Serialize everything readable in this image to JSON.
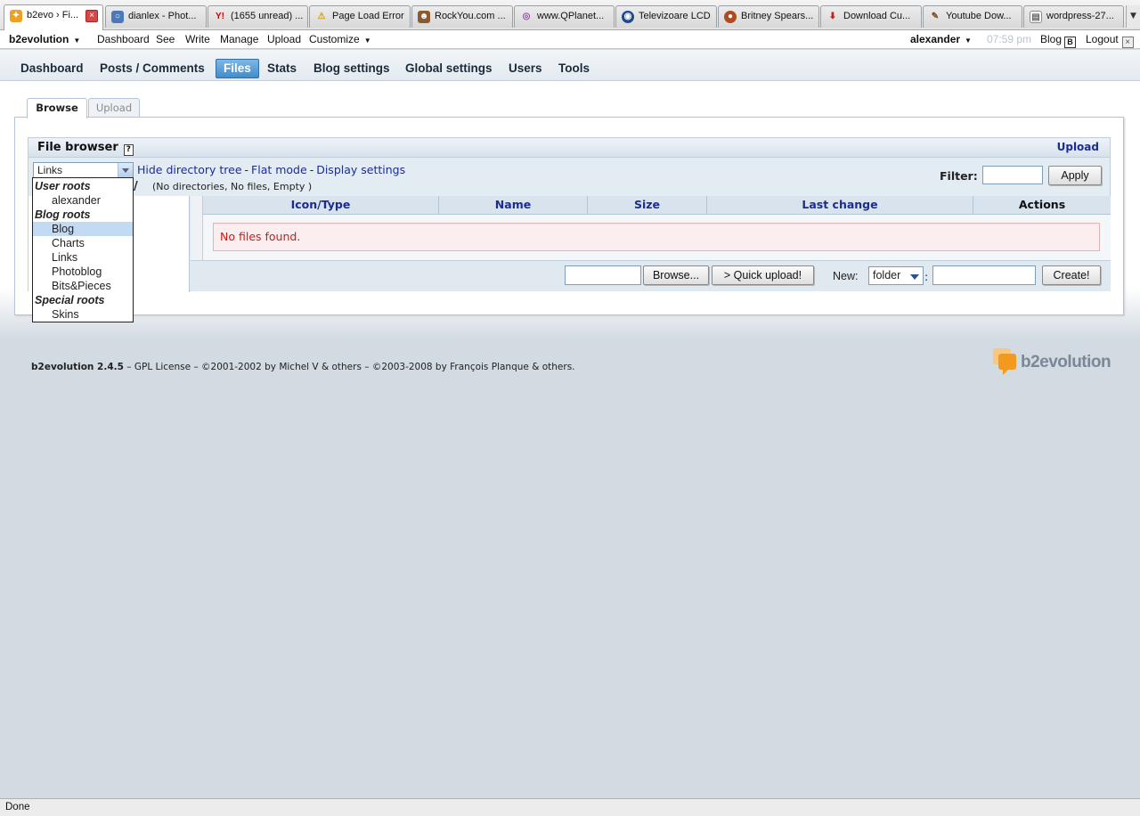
{
  "browser": {
    "tabs": [
      {
        "title": "b2evo › Fi...",
        "icon": "b2evo-icon",
        "active": true
      },
      {
        "title": "dianlex - Phot...",
        "icon": "photo-icon"
      },
      {
        "title": "(1655 unread) ...",
        "icon": "yahoo-icon"
      },
      {
        "title": "Page Load Error",
        "icon": "warning-icon"
      },
      {
        "title": "RockYou.com ...",
        "icon": "rockyou-icon"
      },
      {
        "title": "www.QPlanet...",
        "icon": "qplanet-icon"
      },
      {
        "title": "Televizoare LCD",
        "icon": "tv-icon"
      },
      {
        "title": "Britney Spears...",
        "icon": "globe-icon"
      },
      {
        "title": "Download Cu...",
        "icon": "download-icon"
      },
      {
        "title": "Youtube Dow...",
        "icon": "youtube-icon"
      },
      {
        "title": "wordpress-27...",
        "icon": "page-icon"
      }
    ],
    "status": "Done"
  },
  "adminbar": {
    "brand": "b2evolution",
    "items": [
      "Dashboard",
      "See",
      "Write",
      "Manage",
      "Upload",
      "Customize"
    ],
    "user": "alexander",
    "time": "07:59 pm",
    "blog": "Blog",
    "logout": "Logout"
  },
  "mainnav": {
    "items": [
      "Dashboard",
      "Posts / Comments",
      "Files",
      "Stats",
      "Blog settings",
      "Global settings",
      "Users",
      "Tools"
    ],
    "active": "Files"
  },
  "subtabs": {
    "browse": "Browse",
    "upload": "Upload"
  },
  "filebrowser": {
    "title": "File browser",
    "upload_link": "Upload",
    "root_selected": "Links",
    "links": {
      "hide_tree": "Hide directory tree",
      "flat_mode": "Flat mode",
      "display_settings": "Display settings"
    },
    "path": "/",
    "path_info": "(No directories, No files, Empty )",
    "filter_label": "Filter:",
    "filter_value": "",
    "apply": "Apply",
    "columns": [
      "Icon/Type",
      "Name",
      "Size",
      "Last change",
      "Actions"
    ],
    "empty_message": "No files found.",
    "browse_btn": "Browse...",
    "quick_upload_btn": "> Quick upload!",
    "new_label": "New:",
    "new_type": "folder",
    "create_btn": "Create!"
  },
  "root_dropdown": {
    "options": [
      {
        "label": "User roots",
        "group": true
      },
      {
        "label": "alexander"
      },
      {
        "label": "Blog roots",
        "group": true
      },
      {
        "label": "Blog",
        "highlighted": true
      },
      {
        "label": "Charts"
      },
      {
        "label": "Links"
      },
      {
        "label": "Photoblog"
      },
      {
        "label": "Bits&Pieces"
      },
      {
        "label": "Special roots",
        "group": true
      },
      {
        "label": "Skins"
      }
    ]
  },
  "footer": {
    "product": "b2evolution 2.4.5",
    "text": " – GPL License – ©2001-2002 by Michel V & others – ©2003-2008 by François Planque & others.",
    "logo_text": "b2evolution"
  },
  "colors": {
    "accent": "#3f8ccc",
    "link": "#1c2d8f",
    "error": "#cc1a1a"
  }
}
